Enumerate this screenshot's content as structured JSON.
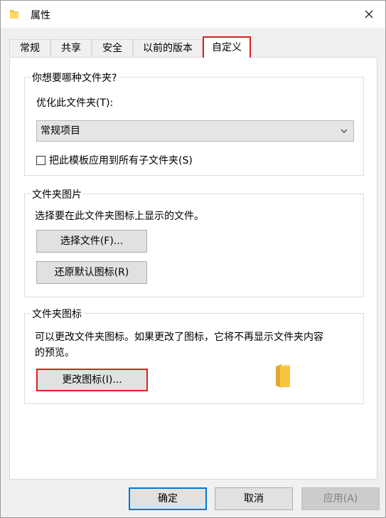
{
  "window": {
    "title": "属性"
  },
  "tabs": [
    {
      "label": "常规"
    },
    {
      "label": "共享"
    },
    {
      "label": "安全"
    },
    {
      "label": "以前的版本"
    },
    {
      "label": "自定义"
    }
  ],
  "group_type": {
    "title": "你想要哪种文件夹?",
    "optimize_label": "优化此文件夹(T):",
    "selected_option": "常规项目",
    "apply_subfolders_label": "把此模板应用到所有子文件夹(S)"
  },
  "group_pictures": {
    "title": "文件夹图片",
    "description": "选择要在此文件夹图标上显示的文件。",
    "choose_file_label": "选择文件(F)...",
    "restore_default_label": "还原默认图标(R)"
  },
  "group_icons": {
    "title": "文件夹图标",
    "description_line1": "可以更改文件夹图标。如果更改了图标，它将不再显示文件夹内容",
    "description_line2": "的预览。",
    "change_icon_label": "更改图标(I)..."
  },
  "footer": {
    "ok_label": "确定",
    "cancel_label": "取消",
    "apply_label": "应用(A)"
  },
  "colors": {
    "highlight": "#e02020",
    "primary_border": "#0078d7",
    "folder_yellow": "#f5c542"
  }
}
